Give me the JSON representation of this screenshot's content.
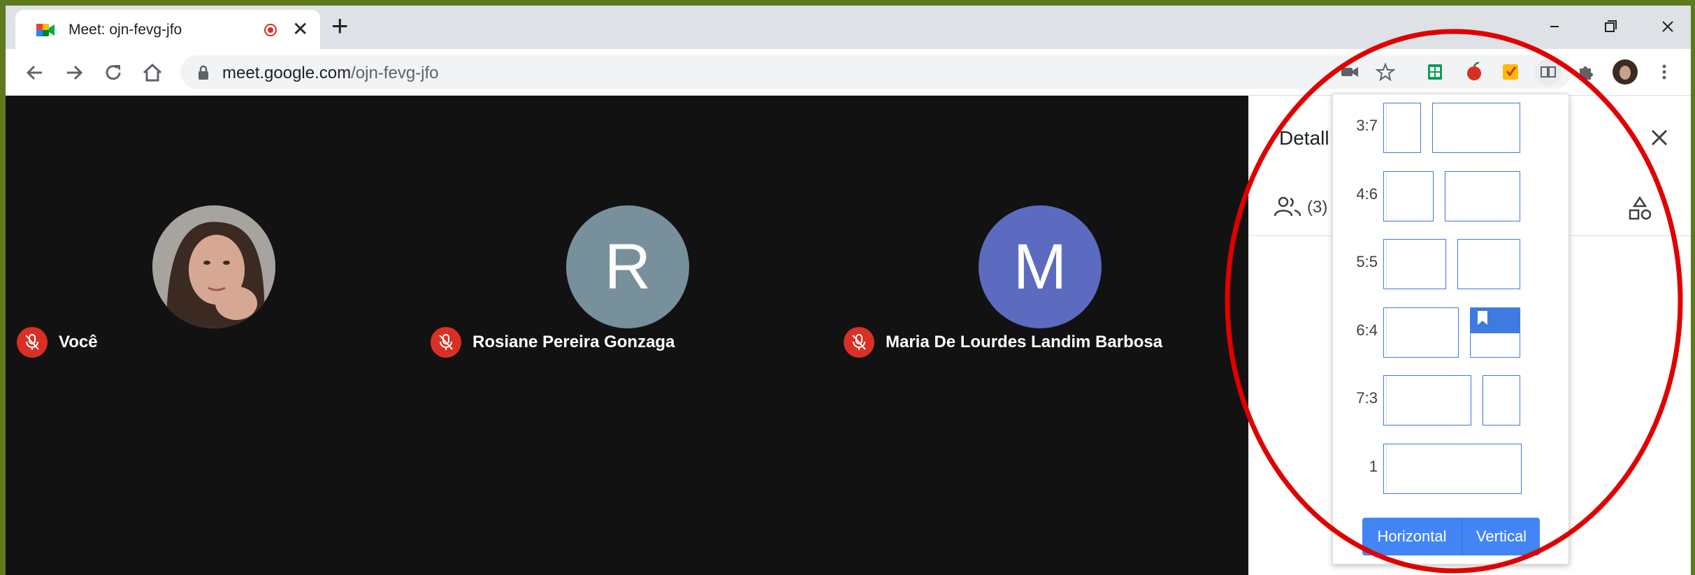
{
  "browser": {
    "tab_title": "Meet: ojn-fevg-jfo",
    "url_host": "meet.google.com",
    "url_path": "/ojn-fevg-jfo",
    "new_tab_label": "+",
    "close_tab_label": "✕"
  },
  "participants": [
    {
      "name": "Você",
      "avatar": "photo",
      "color": "#8d8a86"
    },
    {
      "name": "Rosiane Pereira Gonzaga",
      "initial": "R",
      "color": "#78909c"
    },
    {
      "name": "Maria De Lourdes Landim Barbosa",
      "initial": "M",
      "color": "#5c6bc0"
    }
  ],
  "side_panel": {
    "title": "Detall",
    "people_count": "(3)"
  },
  "split_popup": {
    "ratios": [
      {
        "label": "3:7"
      },
      {
        "label": "4:6"
      },
      {
        "label": "5:5"
      },
      {
        "label": "6:4",
        "selected": true
      },
      {
        "label": "7:3"
      },
      {
        "label": "1"
      }
    ],
    "horizontal_label": "Horizontal",
    "vertical_label": "Vertical",
    "accent_color": "#4285f4"
  },
  "colors": {
    "mic_off": "#d93025",
    "annotation_ellipse": "#e00000"
  }
}
